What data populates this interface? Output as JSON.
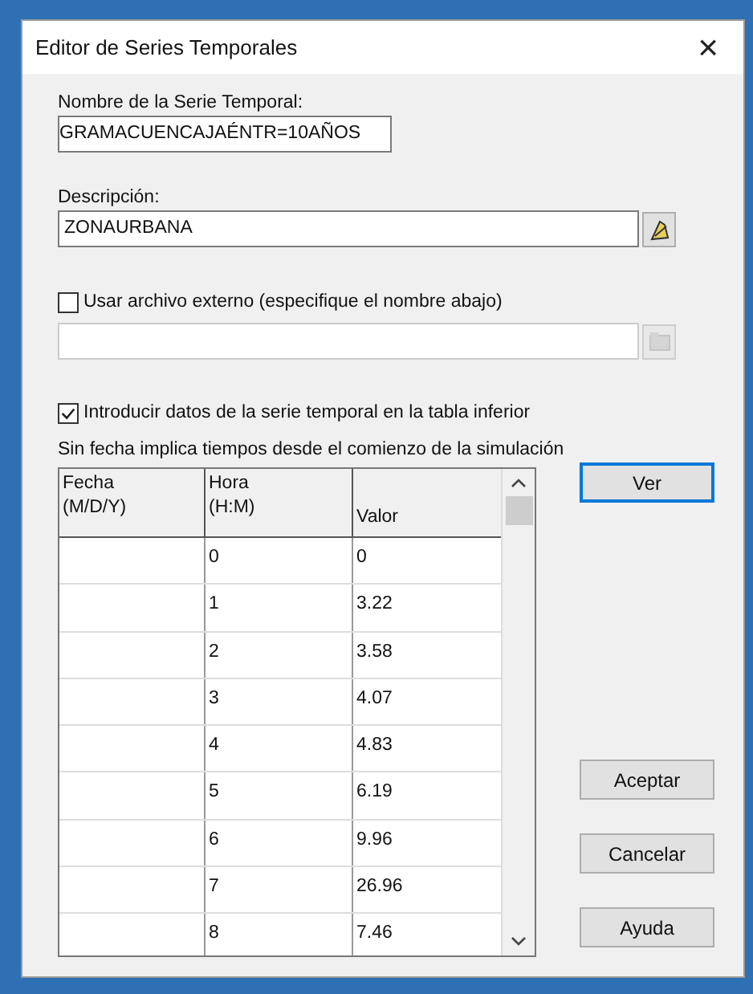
{
  "window": {
    "title": "Editor de Series Temporales",
    "close": "×"
  },
  "name_label": "Nombre de la Serie Temporal:",
  "name_value": "GRAMACUENCAJAÉNTR=10AÑOS",
  "description_label": "Descripción:",
  "description_value": "ZONAURBANA",
  "external_file": {
    "label": "Usar archivo externo (especifique el nombre abajo)",
    "checked": false
  },
  "file_field": {
    "disabled": true
  },
  "table_entry": {
    "label": "Introducir datos de la serie temporal en la tabla inferior",
    "checked": true
  },
  "note": "Sin fecha implica tiempos desde el comienzo de la simulación",
  "table": {
    "columns": [
      "Fecha\n(M/D/Y)",
      "Hora\n(H:M)",
      "Valor"
    ],
    "rows": [
      [
        "",
        "0",
        "0"
      ],
      [
        "",
        "1",
        "3.22"
      ],
      [
        "",
        "2",
        "3.58"
      ],
      [
        "",
        "3",
        "4.07"
      ],
      [
        "",
        "4",
        "4.83"
      ],
      [
        "",
        "5",
        "6.19"
      ],
      [
        "",
        "6",
        "9.96"
      ],
      [
        "",
        "7",
        "26.96"
      ],
      [
        "",
        "8",
        "7.46"
      ]
    ]
  },
  "buttons": [
    {
      "label": "Ver",
      "selected": true
    },
    {
      "label": "Aceptar",
      "selected": false
    },
    {
      "label": "Cancelar",
      "selected": false
    },
    {
      "label": "Ayuda",
      "selected": false
    }
  ]
}
